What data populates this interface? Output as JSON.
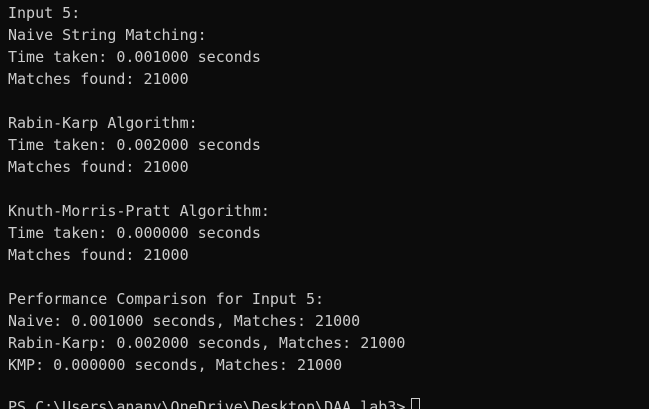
{
  "terminal": {
    "lines": {
      "l0": "Input 5:",
      "l1": "Naive String Matching:",
      "l2": "Time taken: 0.001000 seconds",
      "l3": "Matches found: 21000",
      "l5": "Rabin-Karp Algorithm:",
      "l6": "Time taken: 0.002000 seconds",
      "l7": "Matches found: 21000",
      "l9": "Knuth-Morris-Pratt Algorithm:",
      "l10": "Time taken: 0.000000 seconds",
      "l11": "Matches found: 21000",
      "l13": "Performance Comparison for Input 5:",
      "l14": "Naive: 0.001000 seconds, Matches: 21000",
      "l15": "Rabin-Karp: 0.002000 seconds, Matches: 21000",
      "l16": "KMP: 0.000000 seconds, Matches: 21000"
    },
    "prompt": "PS C:\\Users\\anany\\OneDrive\\Desktop\\DAA lab3>",
    "colors": {
      "background": "#0c0c0c",
      "foreground": "#cccccc"
    }
  }
}
